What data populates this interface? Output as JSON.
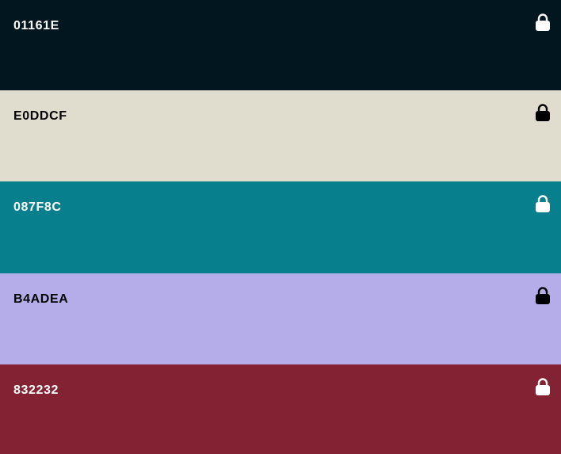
{
  "palette": {
    "colors": [
      {
        "hex_label": "01161E",
        "color": "#01161E",
        "text_color": "#FFFFFF",
        "lock_icon": "lock-icon",
        "locked": true
      },
      {
        "hex_label": "E0DDCF",
        "color": "#E0DDCF",
        "text_color": "#000000",
        "lock_icon": "lock-icon",
        "locked": true
      },
      {
        "hex_label": "087F8C",
        "color": "#087F8C",
        "text_color": "#FFFFFF",
        "lock_icon": "lock-icon",
        "locked": true
      },
      {
        "hex_label": "B4ADEA",
        "color": "#B4ADEA",
        "text_color": "#000000",
        "lock_icon": "lock-icon",
        "locked": true
      },
      {
        "hex_label": "832232",
        "color": "#832232",
        "text_color": "#FFFFFF",
        "lock_icon": "lock-icon",
        "locked": true
      }
    ]
  }
}
